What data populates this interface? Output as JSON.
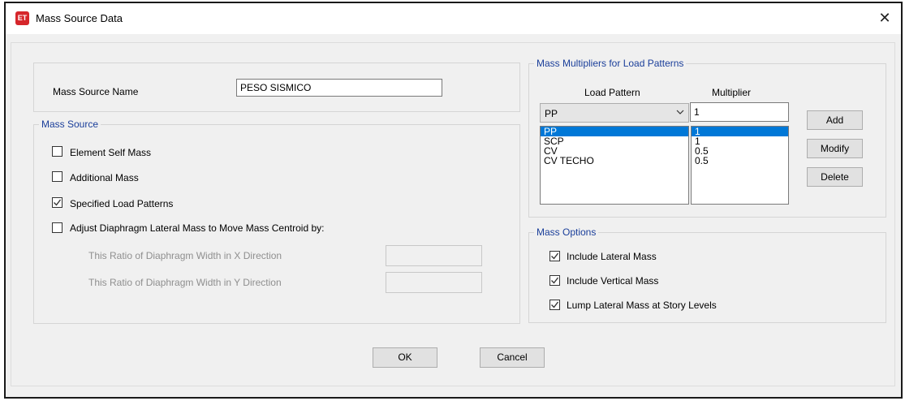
{
  "window": {
    "title": "Mass Source Data",
    "icon_text": "ET"
  },
  "name_group": {
    "label": "Mass Source Name",
    "value": "PESO SISMICO"
  },
  "mass_source": {
    "title": "Mass Source",
    "element_self_mass": {
      "label": "Element Self Mass",
      "checked": false
    },
    "additional_mass": {
      "label": "Additional Mass",
      "checked": false
    },
    "specified_load_patterns": {
      "label": "Specified Load Patterns",
      "checked": true
    },
    "adjust_diaphragm": {
      "label": "Adjust Diaphragm Lateral Mass to Move Mass Centroid by:",
      "checked": false
    },
    "ratio_x": {
      "label": "This Ratio of Diaphragm Width in X Direction",
      "value": ""
    },
    "ratio_y": {
      "label": "This Ratio of Diaphragm Width in Y Direction",
      "value": ""
    }
  },
  "multipliers": {
    "title": "Mass Multipliers for Load Patterns",
    "col_load_pattern": "Load Pattern",
    "col_multiplier": "Multiplier",
    "selected_pattern": "PP",
    "multiplier_value": "1",
    "rows": [
      {
        "pattern": "PP",
        "multiplier": "1"
      },
      {
        "pattern": "SCP",
        "multiplier": "1"
      },
      {
        "pattern": "CV",
        "multiplier": "0.5"
      },
      {
        "pattern": "CV TECHO",
        "multiplier": "0.5"
      }
    ],
    "add_label": "Add",
    "modify_label": "Modify",
    "delete_label": "Delete"
  },
  "mass_options": {
    "title": "Mass Options",
    "include_lateral": {
      "label": "Include Lateral Mass",
      "checked": true
    },
    "include_vertical": {
      "label": "Include Vertical Mass",
      "checked": true
    },
    "lump_lateral": {
      "label": "Lump Lateral Mass at Story Levels",
      "checked": true
    }
  },
  "footer": {
    "ok_label": "OK",
    "cancel_label": "Cancel"
  },
  "colors": {
    "accent": "#0078d7",
    "group_title": "#1a3e9a",
    "icon": "#d6262b"
  }
}
